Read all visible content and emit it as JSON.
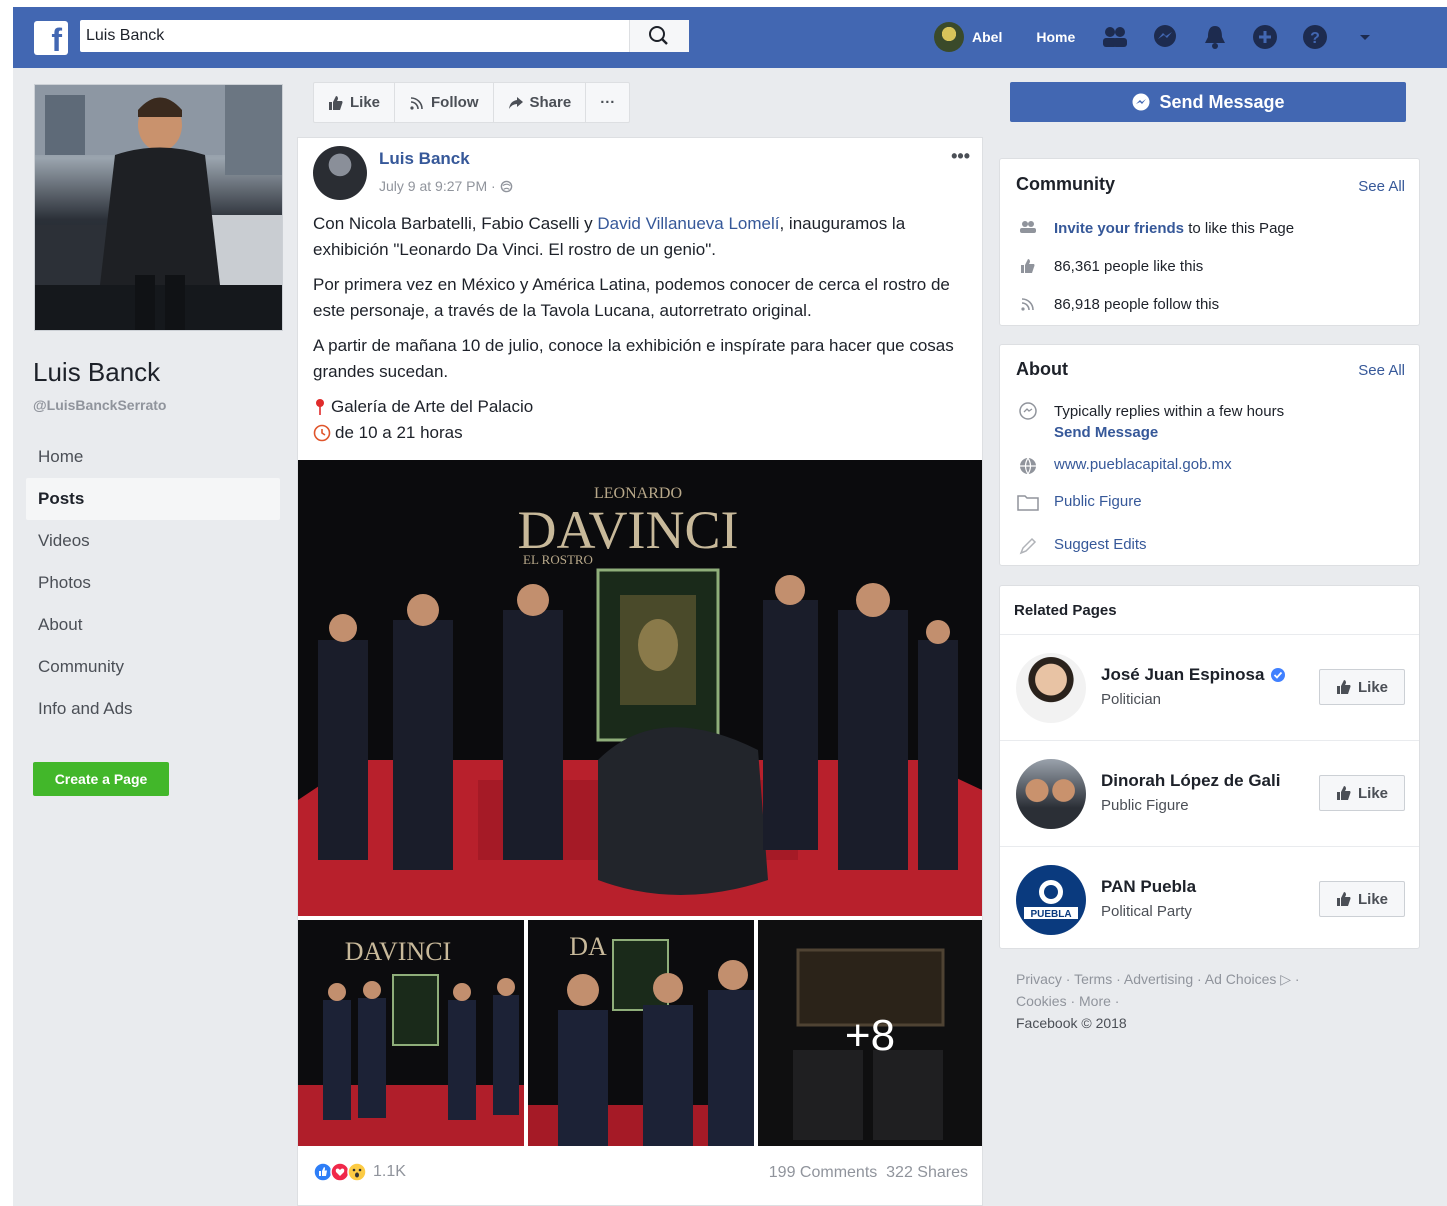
{
  "topbar": {
    "logo": "f",
    "search_value": "Luis Banck",
    "user_name": "Abel",
    "home_label": "Home",
    "icons": [
      "friends-icon",
      "messenger-icon",
      "notifications-icon",
      "create-icon",
      "help-icon",
      "chevron-down-icon"
    ]
  },
  "profile": {
    "name": "Luis Banck",
    "handle": "@LuisBanckSerrato"
  },
  "leftnav": {
    "items": [
      {
        "label": "Home"
      },
      {
        "label": "Posts"
      },
      {
        "label": "Videos"
      },
      {
        "label": "Photos"
      },
      {
        "label": "About"
      },
      {
        "label": "Community"
      },
      {
        "label": "Info and Ads"
      }
    ],
    "active": "Posts",
    "create_page": "Create a Page"
  },
  "actionbar": {
    "like": "Like",
    "follow": "Follow",
    "share": "Share",
    "more": "···"
  },
  "post": {
    "author": "Luis Banck",
    "time": "July 9 at 9:27 PM · ",
    "more": "•••",
    "p1_a": "Con Nicola Barbatelli, Fabio Caselli y ",
    "p1_link": "David Villanueva Lomelí",
    "p1_b": ", inauguramos la exhibición \"Leonardo Da Vinci. El rostro de un genio\".",
    "p2": "Por primera vez en México y América Latina, podemos conocer de cerca el rostro de este personaje, a través de la Tavola Lucana, autorretrato original.",
    "p3": "A partir de mañana 10 de julio, conoce la exhibición e inspírate para hacer que cosas grandes sucedan.",
    "location": "Galería de Arte del Palacio",
    "hours": "de 10 a 21 horas",
    "photo_caption_top": "LEONARDO",
    "photo_caption_main": "DAVINCI",
    "photo_caption_sub": "EL ROSTRO",
    "thumb1_caption": "DAVINCI",
    "thumb2_caption": "DA",
    "more_photos": "+8",
    "reactions_count": "1.1K",
    "comments": "199 Comments",
    "shares": "322 Shares"
  },
  "right": {
    "send_message": "Send Message",
    "community": {
      "title": "Community",
      "see_all": "See All",
      "invite_link": "Invite your friends",
      "invite_rest": " to like this Page",
      "likes": "86,361 people like this",
      "follows": "86,918 people follow this"
    },
    "about": {
      "title": "About",
      "see_all": "See All",
      "replies": "Typically replies within a few hours",
      "send_message": "Send Message",
      "website": "www.pueblacapital.gob.mx",
      "category": "Public Figure",
      "suggest": "Suggest Edits"
    },
    "related": {
      "title": "Related Pages",
      "like_label": "Like",
      "pages": [
        {
          "name": "José Juan Espinosa",
          "category": "Politician",
          "verified": true
        },
        {
          "name": "Dinorah López de Gali",
          "category": "Public Figure",
          "verified": false
        },
        {
          "name": "PAN Puebla",
          "category": "Political Party",
          "verified": false,
          "avatar_text": "PUEBLA"
        }
      ]
    },
    "footer": {
      "line1": "Privacy · Terms · Advertising · Ad Choices ▷ ·",
      "line2": "Cookies · More ·",
      "copyright": "Facebook © 2018"
    }
  },
  "colors": {
    "brand": "#4267b2",
    "link": "#365899",
    "create_button": "#42b72a",
    "page_bg": "#e9ebee"
  }
}
